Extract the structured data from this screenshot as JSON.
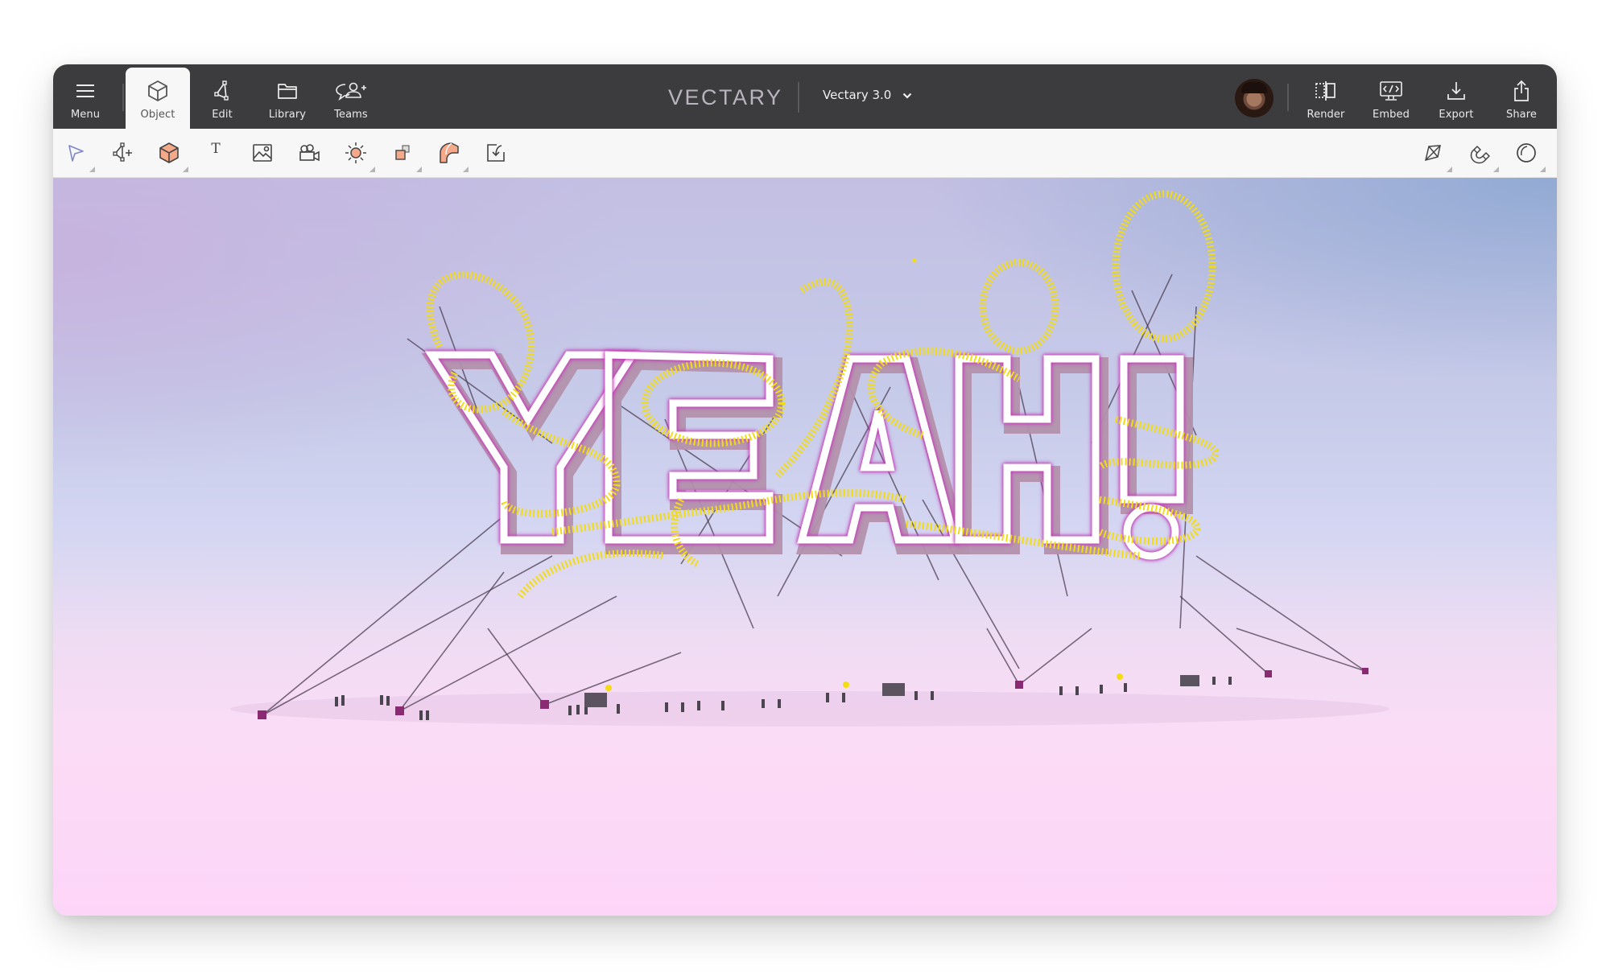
{
  "app": {
    "brand": "VECTARY",
    "project_name": "Vectary 3.0"
  },
  "nav_left": [
    {
      "id": "menu",
      "label": "Menu",
      "icon": "hamburger-icon",
      "active": false
    },
    {
      "id": "object",
      "label": "Object",
      "icon": "cube-icon",
      "active": true
    },
    {
      "id": "edit",
      "label": "Edit",
      "icon": "edit-vertices-icon",
      "active": false
    },
    {
      "id": "library",
      "label": "Library",
      "icon": "folder-icon",
      "active": false
    },
    {
      "id": "teams",
      "label": "Teams",
      "icon": "teams-add-user-icon",
      "active": false
    }
  ],
  "nav_right": [
    {
      "id": "render",
      "label": "Render",
      "icon": "render-split-icon"
    },
    {
      "id": "embed",
      "label": "Embed",
      "icon": "embed-monitor-code-icon"
    },
    {
      "id": "export",
      "label": "Export",
      "icon": "download-icon"
    },
    {
      "id": "share",
      "label": "Share",
      "icon": "share-upload-icon"
    }
  ],
  "tools_left": [
    {
      "id": "select",
      "icon": "cursor-arrow-icon",
      "has_submenu": true
    },
    {
      "id": "add-vertex",
      "icon": "vertex-add-icon",
      "has_submenu": false
    },
    {
      "id": "primitive",
      "icon": "box-primitive-icon",
      "has_submenu": true
    },
    {
      "id": "text",
      "icon": "text-icon",
      "glyph": "T",
      "has_submenu": false
    },
    {
      "id": "image",
      "icon": "image-icon",
      "has_submenu": false
    },
    {
      "id": "camera",
      "icon": "camera-icon",
      "has_submenu": false
    },
    {
      "id": "light",
      "icon": "sun-light-icon",
      "has_submenu": true
    },
    {
      "id": "duplicate",
      "icon": "array-duplicate-icon",
      "has_submenu": true
    },
    {
      "id": "deformer",
      "icon": "bend-deformer-icon",
      "has_submenu": true
    },
    {
      "id": "import",
      "icon": "import-icon",
      "has_submenu": false
    }
  ],
  "tools_right": [
    {
      "id": "snap-grid",
      "icon": "diamond-grid-icon",
      "has_submenu": true
    },
    {
      "id": "magnet",
      "icon": "magnet-icon",
      "has_submenu": true
    },
    {
      "id": "shading",
      "icon": "sphere-shading-icon",
      "has_submenu": true
    }
  ],
  "viewport": {
    "scene_text": "YEAH!",
    "colors": {
      "sky_top_left": "#c5b8e0",
      "sky_top_right": "#8fabd6",
      "ground": "#fdd5f8",
      "letter_glow": "#c53fb9",
      "track": "#f3dc12"
    }
  },
  "colors": {
    "topbar_bg": "#3c3c3f",
    "toolbar_bg": "#f7f7f7",
    "accent_salmon": "#f4a98a"
  }
}
